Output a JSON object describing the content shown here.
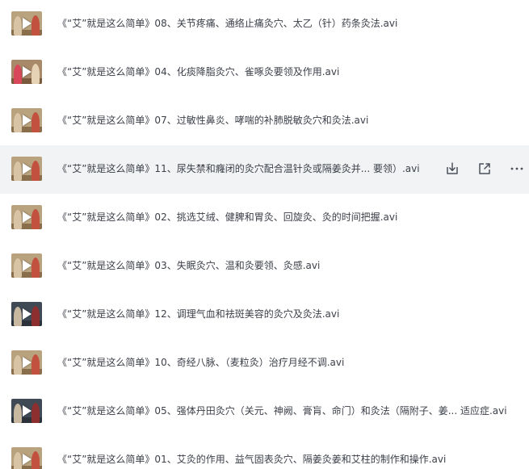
{
  "files": [
    {
      "name": "《“艾”就是这么简单》08、关节疼痛、通络止痛灸穴、太乙（针）药条灸法.avi",
      "thumb": "warm"
    },
    {
      "name": "《“艾”就是这么简单》04、化痰降脂灸穴、雀啄灸要领及作用.avi",
      "thumb": "red"
    },
    {
      "name": "《“艾”就是这么简单》07、过敏性鼻炎、哮喘的补肺脱敏灸穴和灸法.avi",
      "thumb": "warm"
    },
    {
      "name": "《“艾”就是这么简单》11、尿失禁和癃闭的灸穴配合温针灸或隔姜灸并... 要领）.avi",
      "thumb": "warm"
    },
    {
      "name": "《“艾”就是这么简单》02、挑选艾绒、健脾和胃灸、回旋灸、灸的时间把握.avi",
      "thumb": "warm"
    },
    {
      "name": "《“艾”就是这么简单》03、失眠灸穴、温和灸要领、灸感.avi",
      "thumb": "warm"
    },
    {
      "name": "《“艾”就是这么简单》12、调理气血和祛斑美容的灸穴及灸法.avi",
      "thumb": "dark"
    },
    {
      "name": "《“艾”就是这么简单》10、奇经八脉、（麦粒灸）治疗月经不调.avi",
      "thumb": "warm"
    },
    {
      "name": "《“艾”就是这么简单》05、强体丹田灸穴（关元、神阙、膏肓、命门）和灸法（隔附子、姜... 适应症.avi",
      "thumb": "dark"
    },
    {
      "name": "《“艾”就是这么简单》01、艾灸的作用、益气固表灸穴、隔姜灸姜和艾柱的制作和操作.avi",
      "thumb": "warm"
    }
  ],
  "hovered_row": 3,
  "row_actions": {
    "download_icon": "download-icon",
    "share_icon": "share-icon",
    "more_icon": "more-icon"
  },
  "colors": {
    "text": "#3b3f48",
    "hover_bg": "#f2f3f5",
    "icon": "#4a4f5a"
  }
}
